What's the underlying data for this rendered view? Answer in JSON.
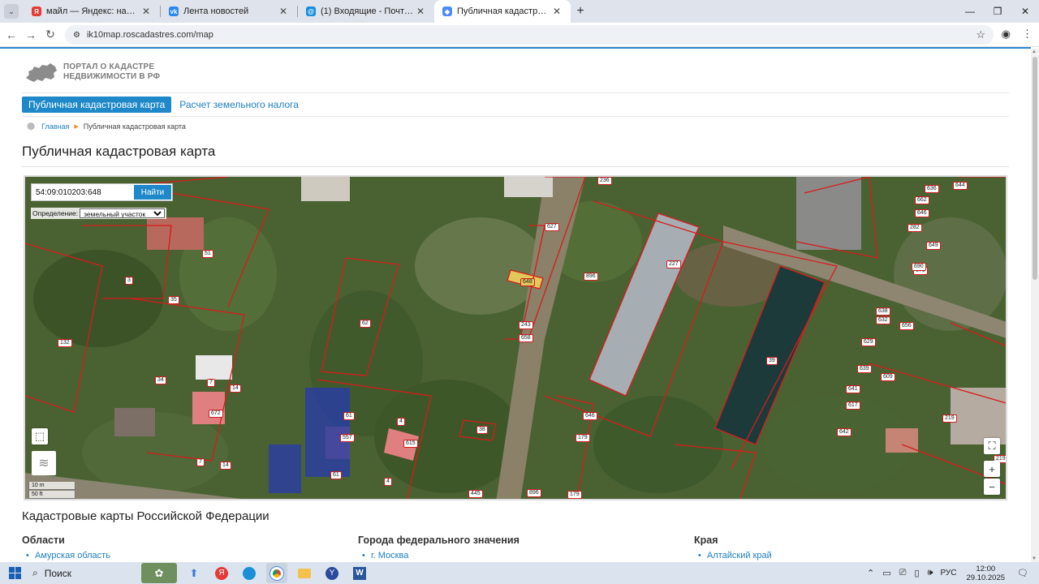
{
  "browser": {
    "tabs": [
      {
        "title": "майл — Яндекс: нашлось 5 млн",
        "icon": "yandex-icon",
        "color": "#e53935",
        "active": false
      },
      {
        "title": "Лента новостей",
        "icon": "vk-icon",
        "color": "#2787f5",
        "active": false
      },
      {
        "title": "(1) Входящие - Почта Mail",
        "icon": "mail-icon",
        "color": "#168de2",
        "active": false
      },
      {
        "title": "Публичная кадастровая карта",
        "icon": "map-icon",
        "color": "#4c8bf5",
        "active": true
      }
    ],
    "url": "ik10map.roscadastres.com/map"
  },
  "site": {
    "logo_line1": "ПОРТАЛ О КАДАСТРЕ",
    "logo_line2": "НЕДВИЖИМОСТИ В РФ",
    "nav_active": "Публичная кадастровая карта",
    "nav_link": "Расчет земельного налога",
    "breadcrumb_home": "Главная",
    "breadcrumb_current": "Публичная кадастровая карта",
    "page_title": "Публичная кадастровая карта"
  },
  "map": {
    "search_value": "54:09:010203:648",
    "search_button": "Найти",
    "definition_label": "Определение:",
    "definition_value": "земельный участок",
    "scale_m": "10 m",
    "scale_ft": "50 ft",
    "zoom_in": "+",
    "zoom_out": "−",
    "parcel_labels": [
      "648",
      "627",
      "896",
      "227",
      "39",
      "243",
      "658",
      "62",
      "3",
      "35",
      "132",
      "34",
      "7",
      "672",
      "14",
      "51",
      "61",
      "557",
      "4",
      "615",
      "38",
      "179",
      "445",
      "896",
      "179",
      "646",
      "219",
      "641",
      "617",
      "642",
      "639",
      "629",
      "609",
      "638",
      "656",
      "632",
      "649",
      "875",
      "690",
      "636",
      "662",
      "646",
      "282",
      "644",
      "236",
      "219",
      "7",
      "14",
      "61",
      "4"
    ]
  },
  "sections": {
    "title": "Кадастровые карты Российской Федерации",
    "columns": [
      {
        "heading": "Области",
        "items": [
          "Амурская область"
        ]
      },
      {
        "heading": "Города федерального значения",
        "items": [
          "г. Москва"
        ]
      },
      {
        "heading": "Края",
        "items": [
          "Алтайский край"
        ]
      }
    ]
  },
  "taskbar": {
    "search_label": "Поиск",
    "lang": "РУС",
    "time": "12:00",
    "date": "29.10.2025"
  }
}
